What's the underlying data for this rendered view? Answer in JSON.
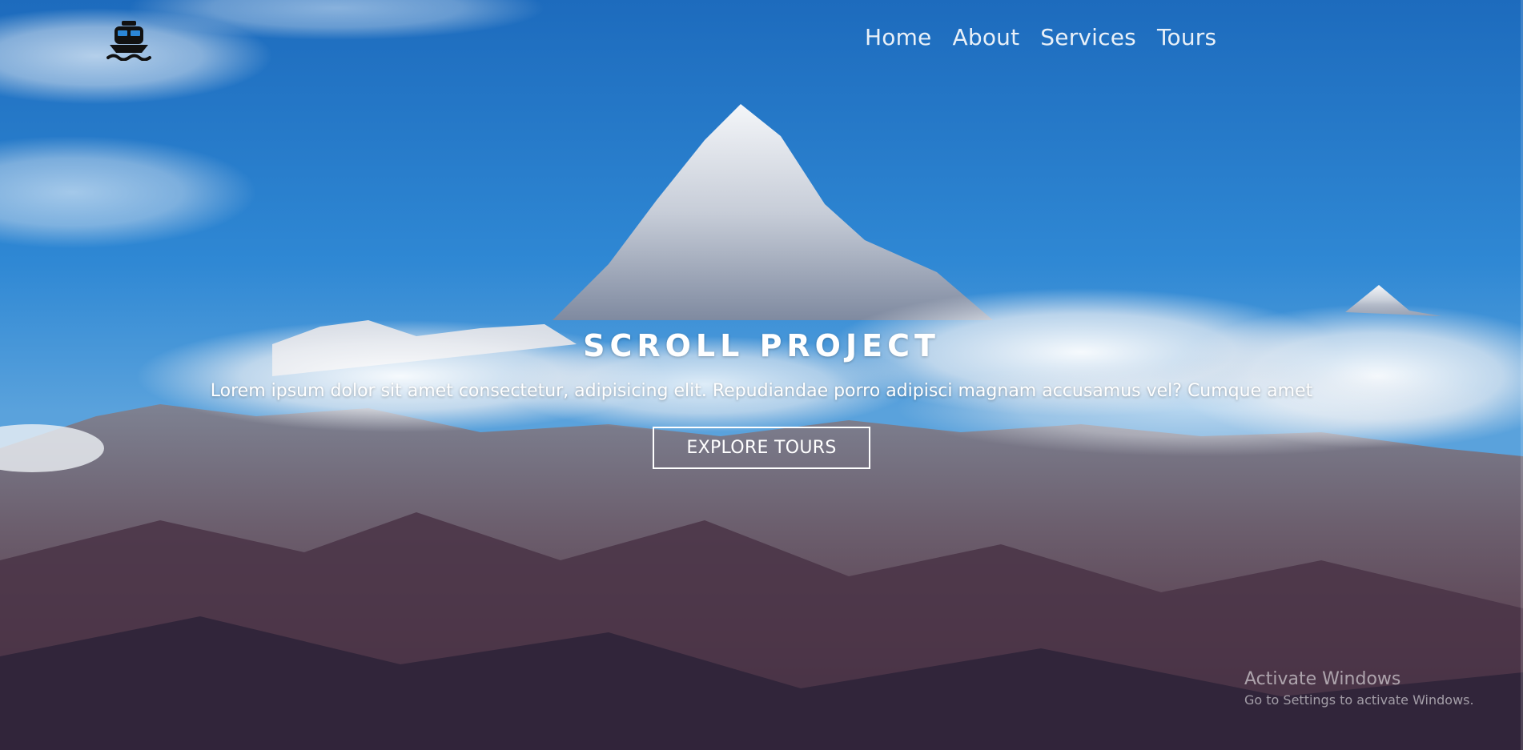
{
  "nav": {
    "logo_icon": "ship-icon",
    "links": [
      {
        "label": "Home"
      },
      {
        "label": "About"
      },
      {
        "label": "Services"
      },
      {
        "label": "Tours"
      }
    ]
  },
  "hero": {
    "title": "SCROLL PROJECT",
    "text": "Lorem ipsum dolor sit amet consectetur, adipisicing elit. Repudiandae porro adipisci magnam accusamus vel? Cumque amet",
    "button_label": "EXPLORE TOURS",
    "background": "mountain-photo"
  },
  "watermark": {
    "title": "Activate Windows",
    "subtitle": "Go to Settings to activate Windows."
  },
  "colors": {
    "sky": "#2b86d6",
    "text": "#ffffff"
  }
}
